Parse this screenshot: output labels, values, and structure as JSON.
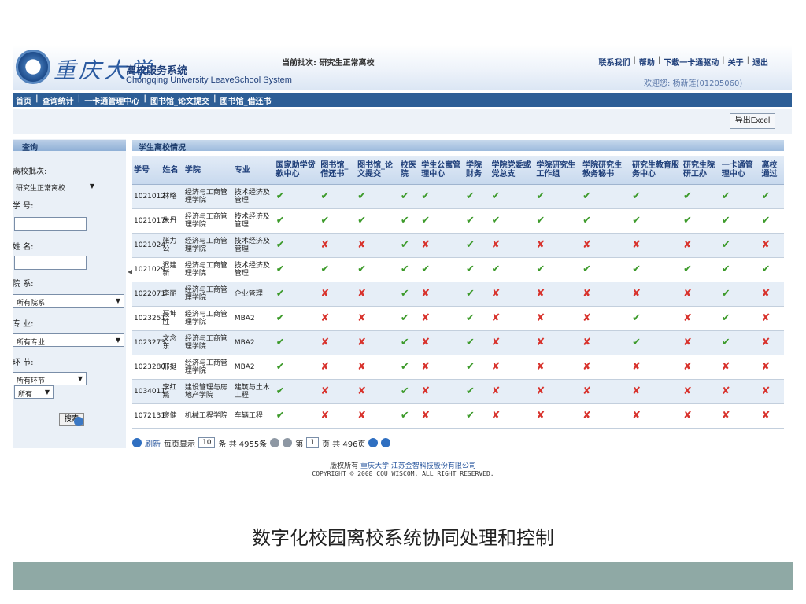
{
  "header": {
    "university_name": "重庆大学",
    "system_title_cn": "离校服务系统",
    "system_title_en": "Chongqing University LeaveSchool System",
    "batch_label": "当前批次: 研究生正常离校",
    "top_links": [
      "联系我们",
      "帮助",
      "下载一卡通驱动",
      "关于",
      "退出"
    ],
    "welcome": "欢迎您: 杨新莲(01205060)"
  },
  "nav": {
    "items": [
      "首页",
      "查询统计",
      "一卡通管理中心",
      "图书馆_论文提交",
      "图书馆_借还书"
    ]
  },
  "toolbar": {
    "export_label": "导出Excel"
  },
  "query_panel": {
    "title": "查询",
    "batch_label": "离校批次:",
    "batch_value": "研究生正常离校",
    "student_id_label": "学 号:",
    "student_id_value": "",
    "name_label": "姓 名:",
    "name_value": "",
    "dept_label": "院 系:",
    "dept_value": "所有院系",
    "major_label": "专 业:",
    "major_value": "所有专业",
    "step_label": "环 节:",
    "step_value": "所有环节",
    "status_value": "所有",
    "search_label": "搜索"
  },
  "table": {
    "title": "学生离校情况",
    "columns": [
      "学号",
      "姓名",
      "学院",
      "专业",
      "国家助学贷款中心",
      "图书馆_借还书",
      "图书馆_论文提交",
      "校医院",
      "学生公寓管理中心",
      "学院财务",
      "学院党委或党总支",
      "学院研究生工作组",
      "学院研究生教务秘书",
      "研究生教育服务中心",
      "研究生院研工办",
      "一卡通管理中心",
      "离校通过"
    ],
    "rows": [
      {
        "id": "1021012",
        "name": "林略",
        "college": "经济与工商管理学院",
        "major": "技术经济及管理",
        "status": [
          1,
          1,
          1,
          1,
          1,
          1,
          1,
          1,
          1,
          1,
          1,
          1,
          1
        ]
      },
      {
        "id": "1021017",
        "name": "朱丹",
        "college": "经济与工商管理学院",
        "major": "技术经济及管理",
        "status": [
          1,
          1,
          1,
          1,
          1,
          1,
          1,
          1,
          1,
          1,
          1,
          1,
          1
        ]
      },
      {
        "id": "1021024",
        "name": "张力公",
        "college": "经济与工商管理学院",
        "major": "技术经济及管理",
        "status": [
          1,
          0,
          0,
          1,
          0,
          1,
          0,
          0,
          0,
          0,
          0,
          1,
          0
        ]
      },
      {
        "id": "1021029",
        "name": "迟建新",
        "college": "经济与工商管理学院",
        "major": "技术经济及管理",
        "status": [
          1,
          1,
          1,
          1,
          1,
          1,
          1,
          1,
          1,
          1,
          1,
          1,
          1
        ]
      },
      {
        "id": "1022071",
        "name": "李丽",
        "college": "经济与工商管理学院",
        "major": "企业管理",
        "status": [
          1,
          0,
          0,
          1,
          0,
          1,
          0,
          0,
          0,
          0,
          0,
          1,
          0
        ]
      },
      {
        "id": "1023251",
        "name": "聂坤胜",
        "college": "经济与工商管理学院",
        "major": "MBA2",
        "status": [
          1,
          0,
          0,
          1,
          0,
          1,
          0,
          0,
          0,
          1,
          0,
          1,
          0
        ]
      },
      {
        "id": "1023273",
        "name": "文念东",
        "college": "经济与工商管理学院",
        "major": "MBA2",
        "status": [
          1,
          0,
          0,
          1,
          0,
          1,
          0,
          0,
          0,
          1,
          0,
          1,
          0
        ]
      },
      {
        "id": "1023280",
        "name": "邢挺",
        "college": "经济与工商管理学院",
        "major": "MBA2",
        "status": [
          1,
          0,
          0,
          1,
          0,
          1,
          0,
          0,
          0,
          0,
          0,
          0,
          0
        ]
      },
      {
        "id": "1034011",
        "name": "李红燕",
        "college": "建设管理与房地产学院",
        "major": "建筑与土木工程",
        "status": [
          1,
          0,
          0,
          1,
          0,
          1,
          0,
          0,
          0,
          0,
          0,
          0,
          0
        ]
      },
      {
        "id": "1072131",
        "name": "廖健",
        "college": "机械工程学院",
        "major": "车辆工程",
        "status": [
          1,
          0,
          0,
          1,
          0,
          1,
          0,
          0,
          0,
          0,
          0,
          0,
          0
        ]
      }
    ]
  },
  "pager": {
    "refresh": "刷新",
    "per_page_prefix": "每页显示",
    "per_page": "10",
    "per_page_suffix": "条 共 4955条",
    "page_prefix": "第",
    "page": "1",
    "page_suffix": "页 共 496页"
  },
  "copyright": {
    "line1_prefix": "版权所有",
    "line1_org": "重庆大学 江苏金智科技股份有限公司",
    "line2": "COPYRIGHT © 2008 CQU WISCOM. ALL RIGHT RESERVED."
  },
  "slide_caption": "数字化校园离校系统协同处理和控制",
  "icons": {
    "pass": "check-icon",
    "fail": "cross-icon"
  },
  "colors": {
    "nav_bg": "#2d5e96",
    "pass": "#3c9a2a",
    "fail": "#d8322c",
    "footer_band": "#8fa9a5"
  }
}
